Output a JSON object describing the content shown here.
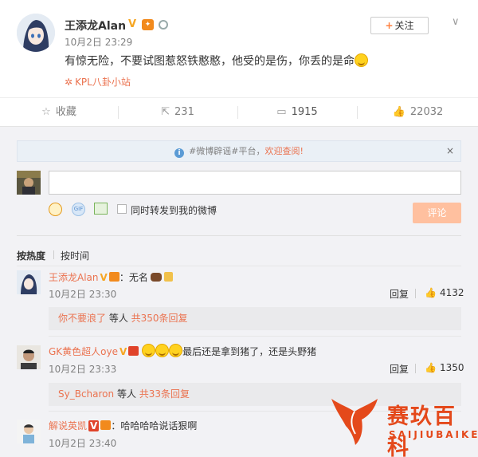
{
  "post": {
    "author": "王添龙Alan",
    "verified_badge": "V",
    "time": "10月2日 23:29",
    "text": "有惊无险，不要试图惹怒铁憨憨，他受的是伤，你丢的是命",
    "source": "KPL八卦小站",
    "follow_label": "关注",
    "follow_plus": "+"
  },
  "actions": {
    "favorite": "收藏",
    "repost_count": "231",
    "comment_count": "1915",
    "like_count": "22032"
  },
  "notice": {
    "text": "#微博辟谣#平台，",
    "link": "欢迎查阅!",
    "close": "×"
  },
  "composer": {
    "sync_label": "同时转发到我的微博",
    "submit_label": "评论",
    "gif_label": "GIF"
  },
  "sort": {
    "hot": "按热度",
    "time": "按时间"
  },
  "comments": [
    {
      "name": "王添龙Alan",
      "badge": "V",
      "text": "：无名",
      "time": "10月2日 23:30",
      "reply": "回复",
      "likes": "4132",
      "sub_name": "你不要浪了",
      "sub_middle": " 等人 ",
      "sub_count": "共350条回复"
    },
    {
      "name": "GK黄色超人oye",
      "badge": "V",
      "text": "最后还是拿到猪了，还是头野猪",
      "time": "10月2日 23:33",
      "reply": "回复",
      "likes": "1350",
      "sub_name": "Sy_Bcharon",
      "sub_middle": " 等人 ",
      "sub_count": "共33条回复"
    },
    {
      "name": "解说英凯",
      "badge": "V",
      "text": "：哈哈哈哈说话狠啊",
      "time": "10月2日 23:40"
    }
  ],
  "watermark": {
    "cn": "赛玖百科",
    "en": "SAIJIUBAIKE"
  },
  "colors": {
    "accent": "#eb7350",
    "badge": "#f6a623",
    "submit_disabled": "#ffc09f",
    "panel_bg": "#f2f2f5"
  }
}
